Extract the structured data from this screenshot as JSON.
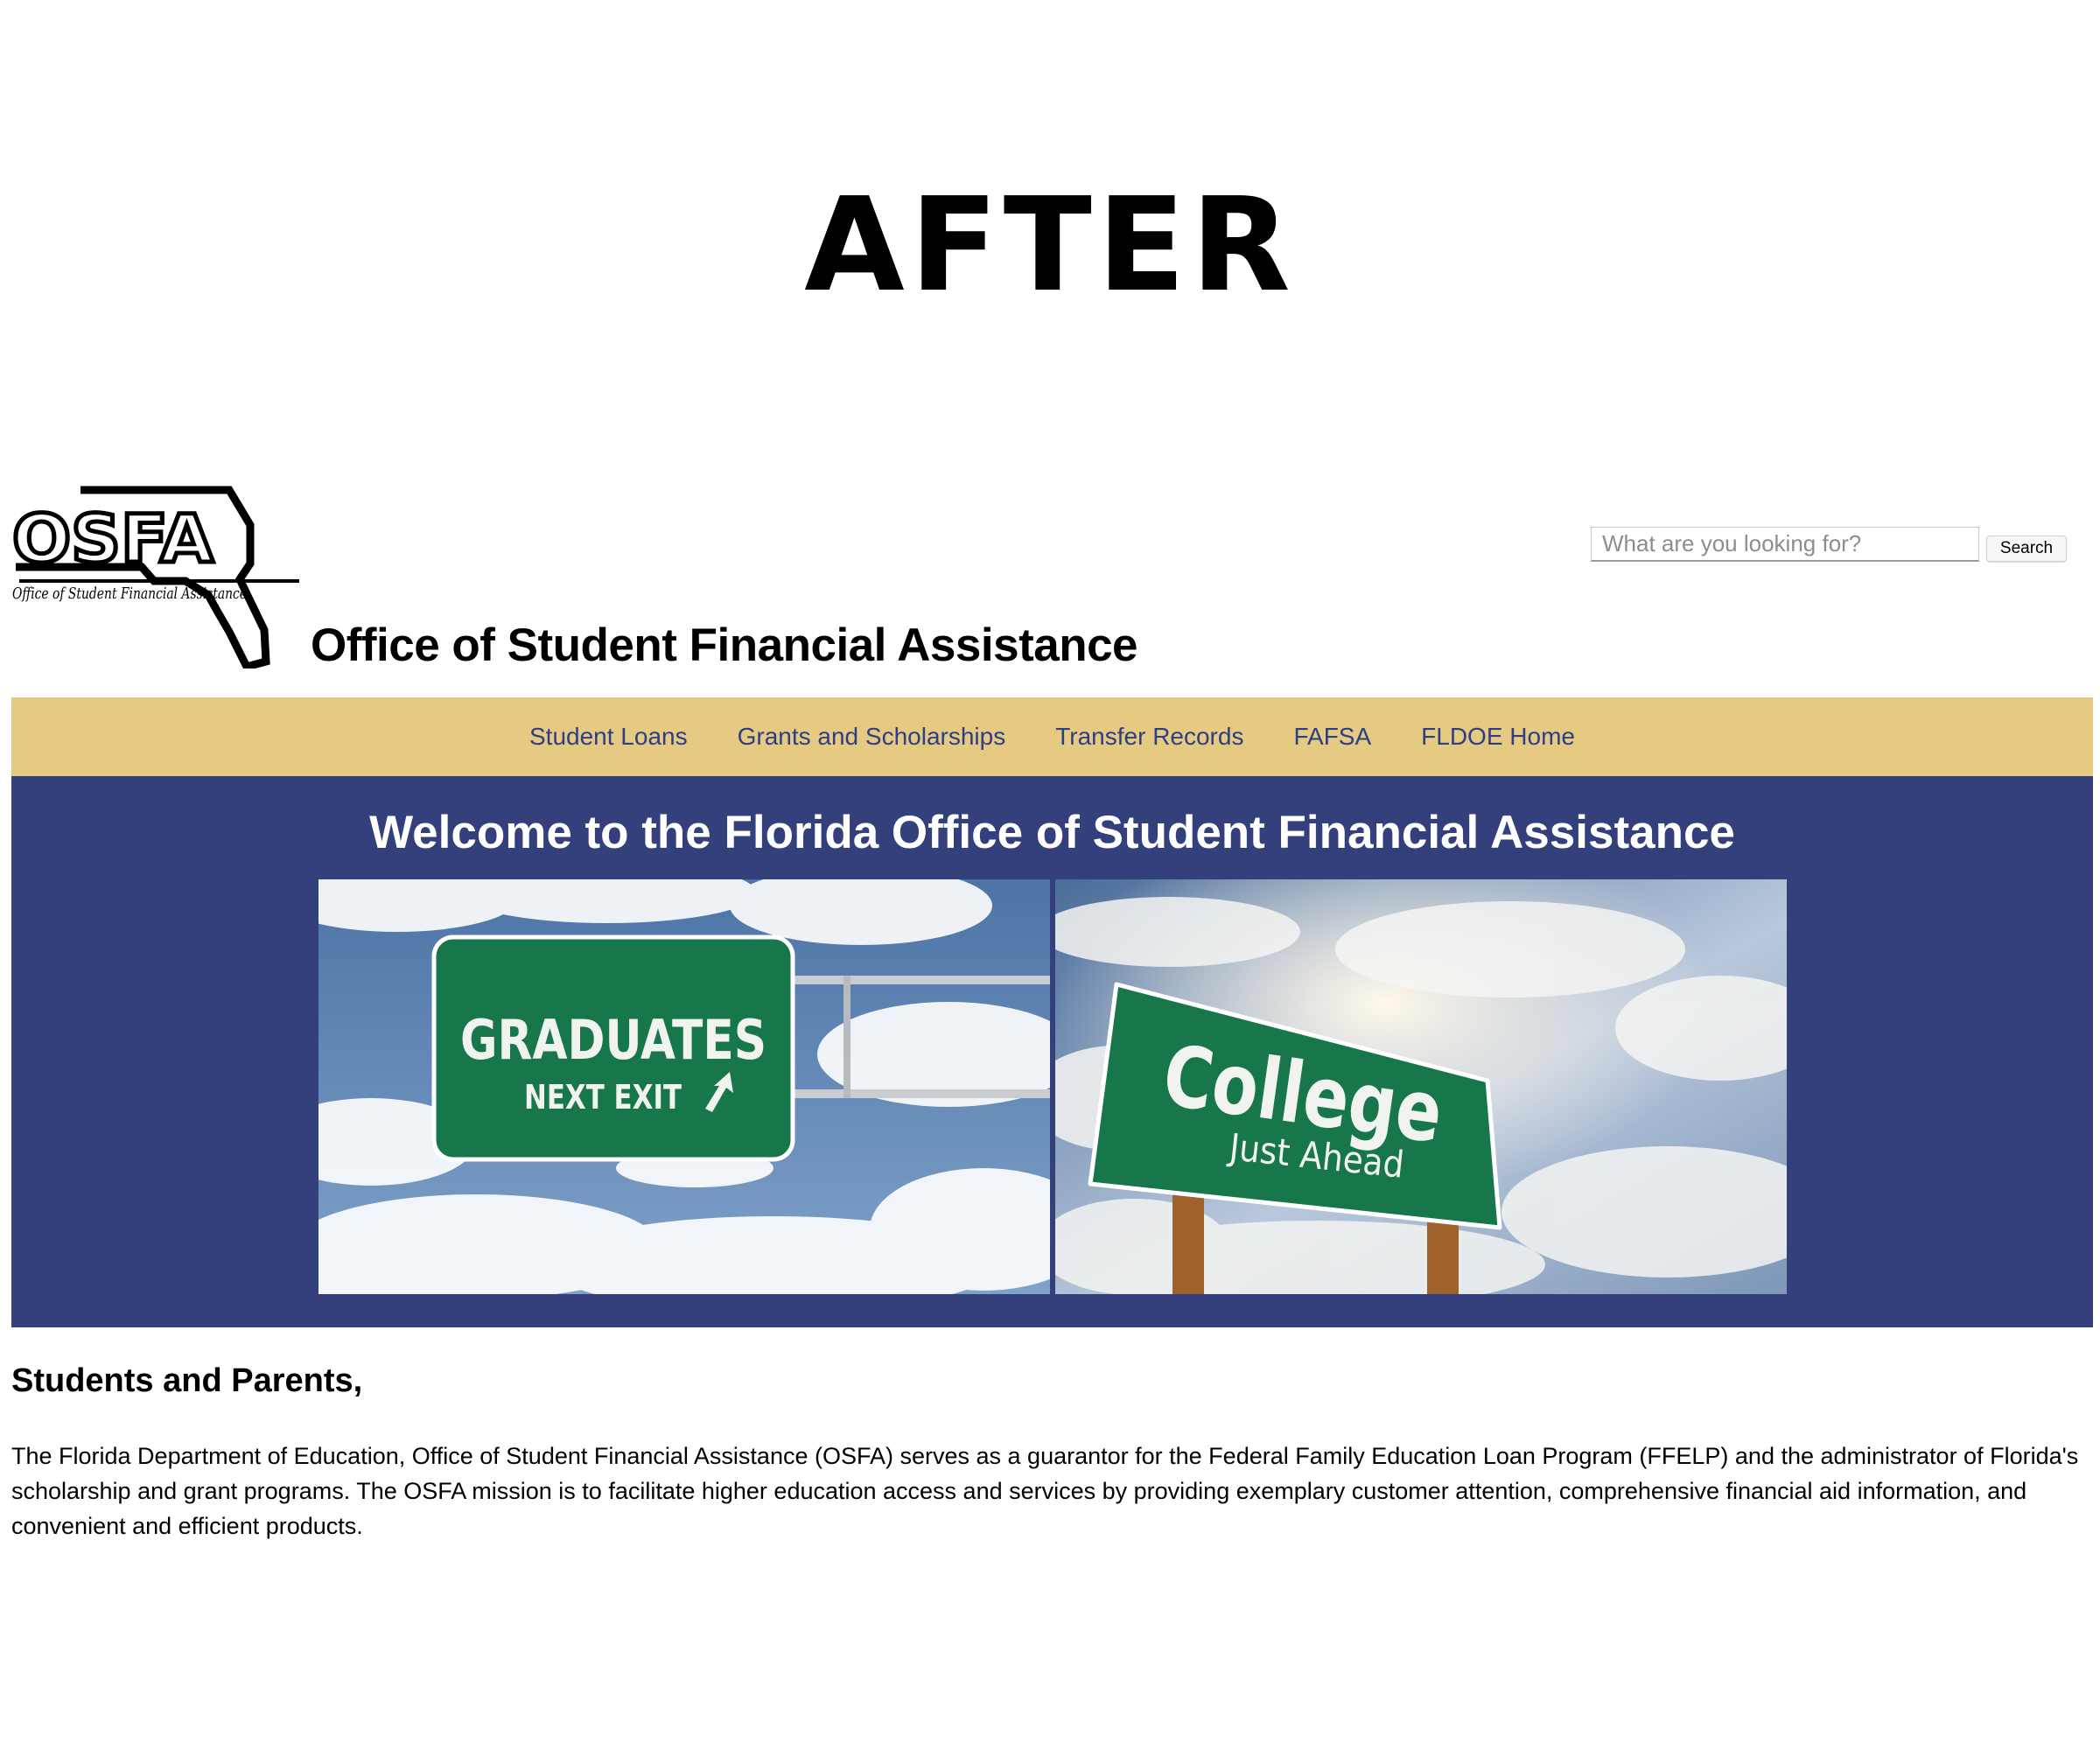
{
  "banner": {
    "label": "AFTER"
  },
  "header": {
    "logo": {
      "text": "OSFA",
      "subtitle": "Office of Student Financial Assistance"
    },
    "site_title": "Office of Student Financial Assistance",
    "search": {
      "placeholder": "What are you looking for?",
      "value": "",
      "button_label": "Search"
    }
  },
  "nav": {
    "items": [
      {
        "label": "Student Loans"
      },
      {
        "label": "Grants and Scholarships"
      },
      {
        "label": "Transfer Records"
      },
      {
        "label": "FAFSA"
      },
      {
        "label": "FLDOE Home"
      }
    ]
  },
  "hero": {
    "heading": "Welcome to the Florida Office of Student Financial Assistance",
    "images": [
      {
        "sign_line1": "GRADUATES",
        "sign_line2": "NEXT EXIT"
      },
      {
        "sign_line1": "College",
        "sign_line2": "Just Ahead"
      }
    ]
  },
  "main": {
    "heading": "Students and Parents,",
    "paragraph": "The Florida Department of Education, Office of Student Financial Assistance (OSFA) serves as a guarantor for the Federal Family Education Loan Program (FFELP) and the administrator of Florida's scholarship and grant programs. The OSFA mission is to facilitate higher education access and services by providing exemplary customer attention, comprehensive financial aid information, and convenient and efficient products."
  },
  "colors": {
    "nav_background": "#e6ca82",
    "nav_text": "#2c3e86",
    "hero_background": "#33407c",
    "sign_green": "#17774a"
  }
}
